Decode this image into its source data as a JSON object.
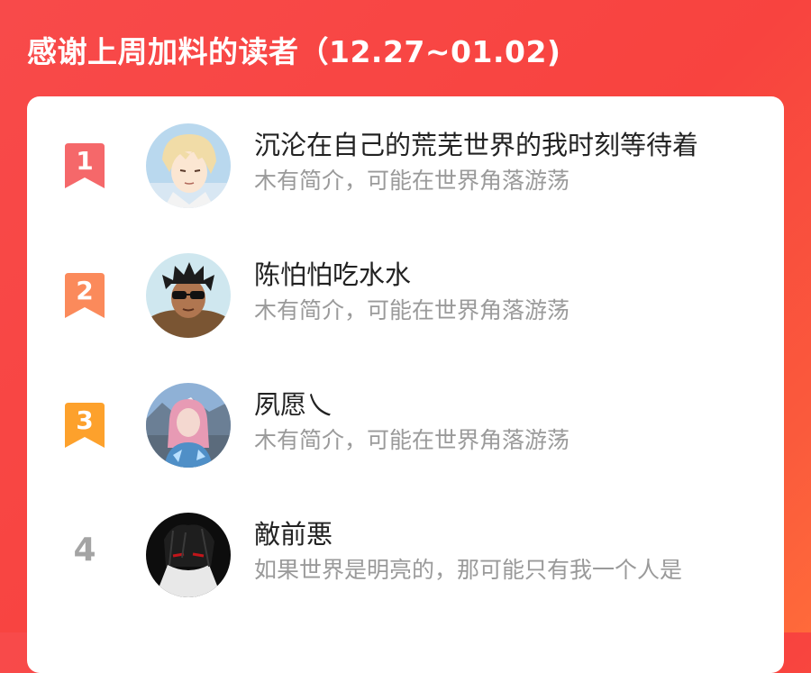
{
  "header": {
    "title": "感谢上周加料的读者（12.27~01.02)"
  },
  "colors": {
    "background": "#f84a4a",
    "rank_1": "#f5686a",
    "rank_2": "#fb8a5b",
    "rank_3": "#fda12c",
    "rank_plain": "#a4a4a4",
    "name_text": "#222222",
    "bio_text": "#9a9a9a"
  },
  "readers": [
    {
      "rank": "1",
      "name": "沉沦在自己的荒芜世界的我时刻等待着",
      "bio": "木有简介，可能在世界角落游荡",
      "avatar_icon": "anime-blonde-boy-avatar"
    },
    {
      "rank": "2",
      "name": "陈怕怕吃水水",
      "bio": "木有简介，可能在世界角落游荡",
      "avatar_icon": "sunglasses-guy-avatar"
    },
    {
      "rank": "3",
      "name": "夙愿乀",
      "bio": "木有简介，可能在世界角落游荡",
      "avatar_icon": "pink-hair-girl-mountain-avatar"
    },
    {
      "rank": "4",
      "name": "敵前悪",
      "bio": "如果世界是明亮的，那可能只有我一个人是",
      "avatar_icon": "dark-sketch-avatar"
    }
  ]
}
